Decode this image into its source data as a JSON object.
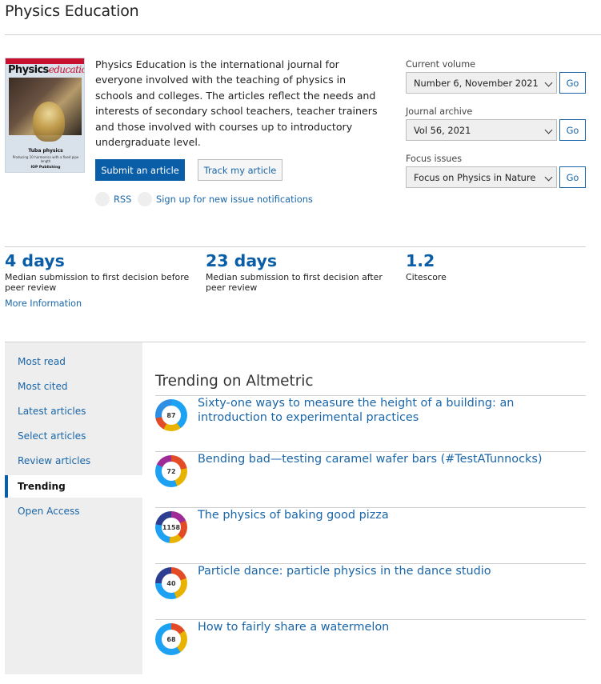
{
  "page": {
    "title": "Physics Education"
  },
  "cover": {
    "logo_main": "Physics",
    "logo_accent": "education",
    "caption": "Tuba physics",
    "subcaption": "Producing 10 harmonics with a fixed pipe length",
    "publisher": "IOP Publishing"
  },
  "description": "Physics Education is the international journal for everyone involved with the teaching of physics in schools and colleges. The articles reflect the needs and interests of secondary school teachers, teacher trainers and those involved with courses up to introductory undergraduate level.",
  "actions": {
    "submit_label": "Submit an article",
    "track_label": "Track my article",
    "rss_label": "RSS",
    "signup_label": "Sign up for new issue notifications"
  },
  "selectors": {
    "current_volume": {
      "label": "Current volume",
      "value": "Number 6, November 2021",
      "go": "Go"
    },
    "journal_archive": {
      "label": "Journal archive",
      "value": "Vol 56, 2021",
      "go": "Go"
    },
    "focus_issues": {
      "label": "Focus issues",
      "value": "Focus on Physics in Nature",
      "go": "Go"
    }
  },
  "metrics": [
    {
      "value": "4 days",
      "label": "Median submission to first decision before peer review"
    },
    {
      "value": "23 days",
      "label": "Median submission to first decision after peer review"
    },
    {
      "value": "1.2",
      "label": "Citescore"
    }
  ],
  "more_info": "More Information",
  "sidebar": {
    "items": [
      {
        "label": "Most read"
      },
      {
        "label": "Most cited"
      },
      {
        "label": "Latest articles"
      },
      {
        "label": "Select articles"
      },
      {
        "label": "Review articles"
      },
      {
        "label": "Trending",
        "active": true
      },
      {
        "label": "Open Access"
      }
    ]
  },
  "trending": {
    "title": "Trending on Altmetric",
    "items": [
      {
        "score": "87",
        "title": "Sixty-one ways to measure the height of a building: an introduction to experimental practices"
      },
      {
        "score": "72",
        "title": "Bending bad—testing caramel wafer bars (#TestATunnocks)"
      },
      {
        "score": "1158",
        "title": "The physics of baking good pizza"
      },
      {
        "score": "40",
        "title": "Particle dance: particle physics in the dance studio"
      },
      {
        "score": "68",
        "title": "How to fairly share a watermelon"
      }
    ]
  },
  "colors": {
    "brand_blue": "#0a5ea8",
    "link_blue": "#1a66a8"
  }
}
